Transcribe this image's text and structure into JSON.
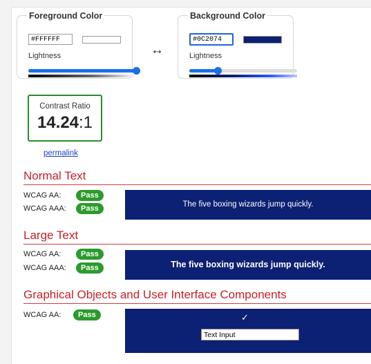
{
  "foreground": {
    "title": "Foreground Color",
    "hex": "#FFFFFF",
    "swatch_color": "#ffffff",
    "lightness_label": "Lightness",
    "lightness_percent": 100
  },
  "swap_icon": "↔",
  "background": {
    "title": "Background Color",
    "hex": "#0C2074",
    "swatch_color": "#0c2074",
    "lightness_label": "Lightness",
    "lightness_percent": 26
  },
  "contrast": {
    "label": "Contrast Ratio",
    "value_main": "14.24",
    "value_suffix": ":1"
  },
  "permalink_label": "permalink",
  "normal_text": {
    "title": "Normal Text",
    "aa_label": "WCAG AA:",
    "aa_result": "Pass",
    "aaa_label": "WCAG AAA:",
    "aaa_result": "Pass",
    "sample": "The five boxing wizards jump quickly."
  },
  "large_text": {
    "title": "Large Text",
    "aa_label": "WCAG AA:",
    "aa_result": "Pass",
    "aaa_label": "WCAG AAA:",
    "aaa_result": "Pass",
    "sample": "The five boxing wizards jump quickly."
  },
  "graphical": {
    "title": "Graphical Objects and User Interface Components",
    "aa_label": "WCAG AA:",
    "aa_result": "Pass",
    "check_glyph": "✓",
    "input_label": "Text Input"
  },
  "colors": {
    "accent_red": "#c8202a",
    "pass_green": "#2c9a2c",
    "link_blue": "#2140c6"
  }
}
